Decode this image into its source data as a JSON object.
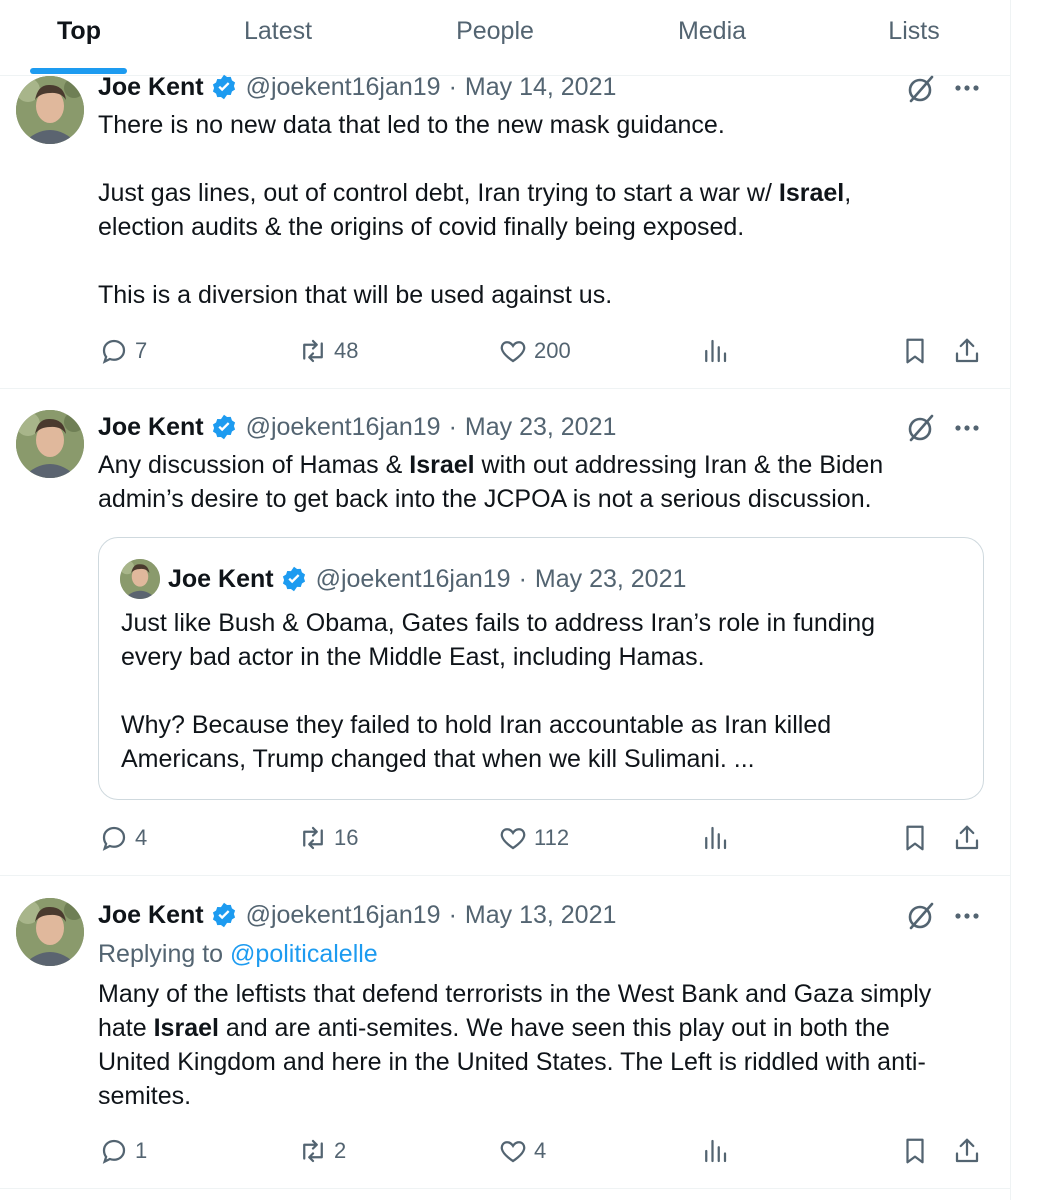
{
  "tabs": {
    "items": [
      {
        "label": "Top"
      },
      {
        "label": "Latest"
      },
      {
        "label": "People"
      },
      {
        "label": "Media"
      },
      {
        "label": "Lists"
      }
    ],
    "active": "Top"
  },
  "colors": {
    "accent": "#1d9bf0",
    "secondary_text": "#536471",
    "primary_text": "#0f1419",
    "border": "#eff3f4"
  },
  "tweets": [
    {
      "author": "Joe Kent",
      "handle": "@joekent16jan19",
      "separator": "·",
      "date": "May 14, 2021",
      "verified": true,
      "text_parts": {
        "p1": "There is no new data that led to the new mask guidance.",
        "p2a": "Just gas lines, out of control debt, Iran trying to start a war w/ ",
        "p2b": "Israel",
        "p2c": ",\nelection audits & the origins of covid finally being exposed.",
        "p3": "This is a diversion that will be used against us."
      },
      "stats": {
        "replies": "7",
        "reposts": "48",
        "likes": "200"
      }
    },
    {
      "author": "Joe Kent",
      "handle": "@joekent16jan19",
      "separator": "·",
      "date": "May 23, 2021",
      "verified": true,
      "text_parts": {
        "a": "Any discussion of Hamas & ",
        "b": "Israel",
        "c": " with out addressing Iran & the Biden\nadmin’s desire to get back into the JCPOA is not a serious discussion."
      },
      "quote": {
        "author": "Joe Kent",
        "handle": "@joekent16jan19",
        "separator": "·",
        "date": "May 23, 2021",
        "p1": "Just like Bush & Obama, Gates fails to address Iran’s role in funding\nevery bad actor in the Middle East, including Hamas.",
        "p2": "Why? Because they failed to hold Iran accountable as Iran killed\nAmericans, Trump changed that when we kill Sulimani. ..."
      },
      "stats": {
        "replies": "4",
        "reposts": "16",
        "likes": "112"
      }
    },
    {
      "author": "Joe Kent",
      "handle": "@joekent16jan19",
      "separator": "·",
      "date": "May 13, 2021",
      "verified": true,
      "replying_to_label": "Replying to ",
      "replying_to_handle": "@politicalelle",
      "text_parts": {
        "a": "Many of the leftists that defend terrorists in the West Bank and Gaza simply\nhate ",
        "b": "Israel",
        "c": " and are anti-semites. We have seen this play out in both the\nUnited Kingdom and here in the United States. The Left is riddled with anti-\nsemites."
      },
      "stats": {
        "replies": "1",
        "reposts": "2",
        "likes": "4"
      }
    }
  ]
}
